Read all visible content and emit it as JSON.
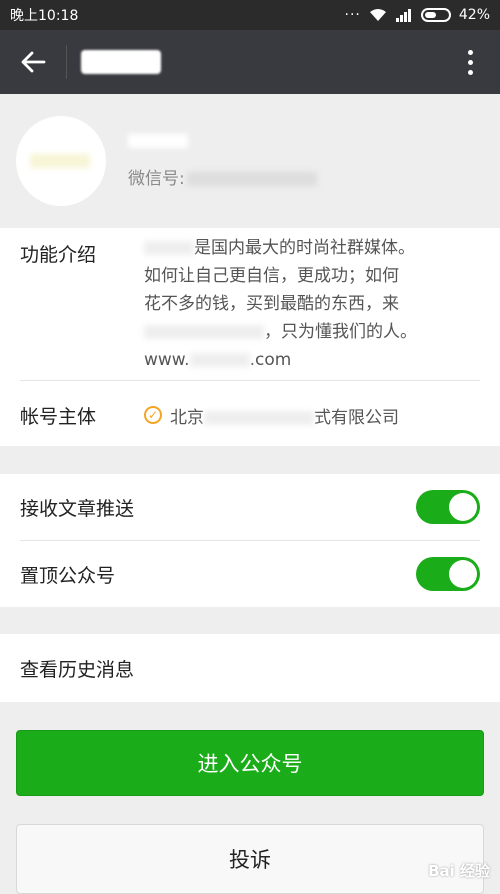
{
  "status_bar": {
    "time": "晚上10:18",
    "signal_dots": "···",
    "battery_percent": "42%"
  },
  "app_bar": {
    "back_icon": "arrow-left-icon",
    "more_icon": "more-vertical-icon"
  },
  "profile": {
    "wechat_id_label": "微信号:"
  },
  "info": {
    "intro_label": "功能介绍",
    "intro_lines": [
      "是国内最大的时尚社群媒体。",
      "如何让自己更自信，更成功；如何",
      "花不多的钱，买到最酷的东西，来",
      "，只为懂我们的人。",
      "www.",
      ".com"
    ],
    "entity_label": "帐号主体",
    "entity_prefix": "北京",
    "entity_suffix": "式有限公司"
  },
  "settings": {
    "push_label": "接收文章推送",
    "push_on": true,
    "top_label": "置顶公众号",
    "top_on": true
  },
  "history": {
    "label": "查看历史消息"
  },
  "buttons": {
    "enter_label": "进入公众号",
    "report_label": "投诉"
  },
  "watermark": "Bai 经验",
  "colors": {
    "toggle_on": "#1aad19",
    "primary_button": "#1aad19",
    "app_bar": "#393a3f",
    "verified": "#f4a523"
  }
}
